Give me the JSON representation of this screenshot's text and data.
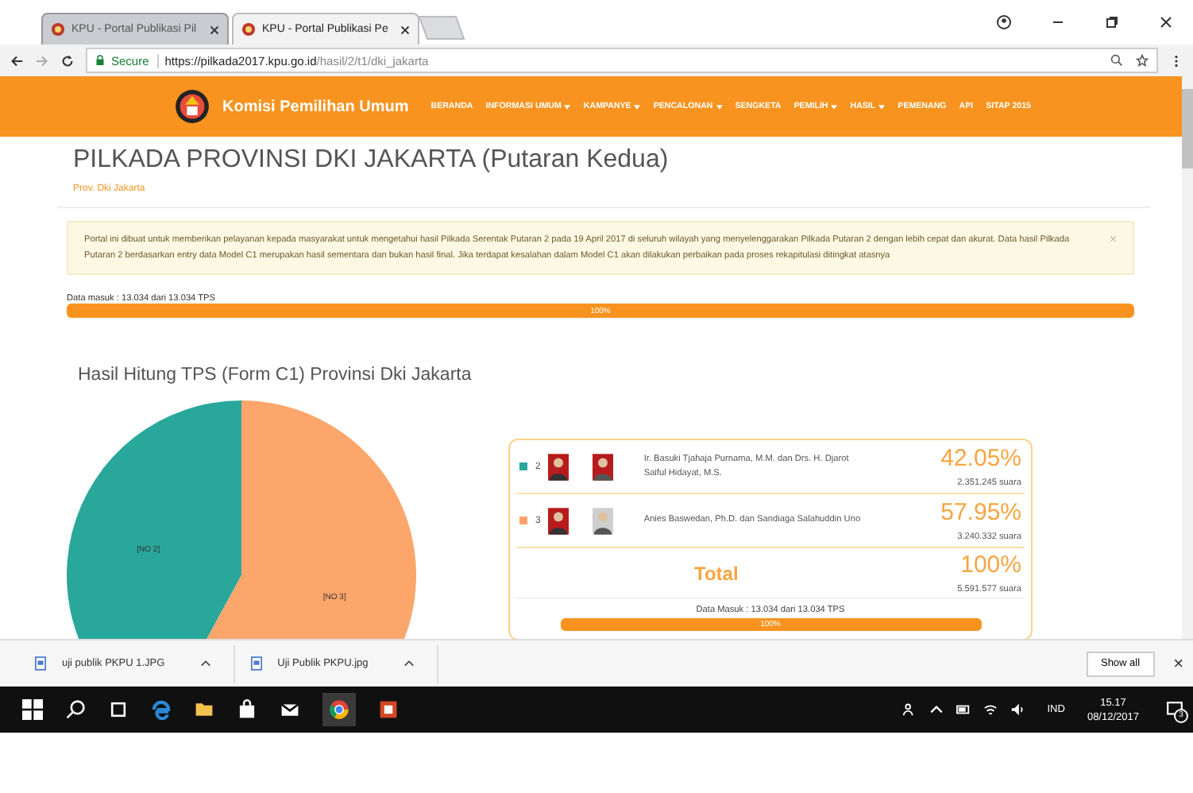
{
  "browser": {
    "tabs": [
      {
        "title": "KPU - Portal Publikasi Pil",
        "selected": false
      },
      {
        "title": "KPU - Portal Publikasi Pe",
        "selected": true
      }
    ],
    "address": {
      "secure_label": "Secure",
      "url_host": "https://pilkada2017.kpu.go.id",
      "url_path": "/hasil/2/t1/dki_jakarta"
    }
  },
  "nav": {
    "brand": "Komisi Pemilihan Umum",
    "items": [
      {
        "label": "BERANDA",
        "dropdown": false
      },
      {
        "label": "INFORMASI UMUM",
        "dropdown": true
      },
      {
        "label": "KAMPANYE",
        "dropdown": true
      },
      {
        "label": "PENCALONAN",
        "dropdown": true
      },
      {
        "label": "SENGKETA",
        "dropdown": false
      },
      {
        "label": "PEMILIH",
        "dropdown": true
      },
      {
        "label": "HASIL",
        "dropdown": true
      },
      {
        "label": "PEMENANG",
        "dropdown": false
      },
      {
        "label": "API",
        "dropdown": false
      },
      {
        "label": "SITAP 2015",
        "dropdown": false
      }
    ]
  },
  "page": {
    "title": "PILKADA PROVINSI DKI JAKARTA (Putaran Kedua)",
    "breadcrumb": "Prov. Dki Jakarta",
    "alert": {
      "text": "Portal ini dibuat untuk memberikan pelayanan kepada masyarakat untuk mengetahui hasil Pilkada Serentak Putaran 2 pada 19 April 2017 di seluruh wilayah yang menyelenggarakan Pilkada Putaran 2 dengan lebih cepat dan akurat. Data hasil Pilkada Putaran 2 berdasarkan entry data Model C1 merupakan hasil sementara dan bukan hasil final. Jika terdapat kesalahan dalam Model C1 akan dilakukan perbaikan pada proses rekapitulasi ditingkat atasnya",
      "close": "×"
    },
    "progress": {
      "label": "Data masuk : 13.034 dari 13.034 TPS",
      "level": 1,
      "reading": "100%"
    },
    "section_title": "Hasil Hitung TPS (Form C1) Provinsi Dki Jakarta",
    "chart_data": {
      "type": "pie",
      "categories": [
        "[NO 2]",
        "[NO 3]"
      ],
      "values": [
        42.05,
        57.95
      ],
      "colors": [
        "#2aa79b",
        "#fda66b"
      ]
    },
    "candidates": [
      {
        "number": "2",
        "color": "#2aa79b",
        "names": "Ir. Basuki Tjahaja Purnama, M.M. dan Drs. H. Djarot Saiful Hidayat, M.S.",
        "percent": "42.05%",
        "votes": "2.351.245 suara"
      },
      {
        "number": "3",
        "color": "#fda66b",
        "names": "Anies Baswedan, Ph.D. dan Sandiaga Salahuddin Uno",
        "percent": "57.95%",
        "votes": "3.240.332 suara"
      }
    ],
    "total": {
      "label": "Total",
      "percent": "100%",
      "votes": "5.591.577 suara"
    },
    "card_progress": {
      "label": "Data Masuk : 13.034 dari 13.034 TPS",
      "level": 1,
      "reading": "100%"
    }
  },
  "downloads": {
    "items": [
      {
        "name": "uji publik PKPU 1.JPG"
      },
      {
        "name": "Uji Publik PKPU.jpg"
      }
    ],
    "show_all": "Show all",
    "close": "×"
  },
  "taskbar": {
    "language": "IND",
    "time": "15.17",
    "date": "08/12/2017",
    "notifications": "3"
  }
}
